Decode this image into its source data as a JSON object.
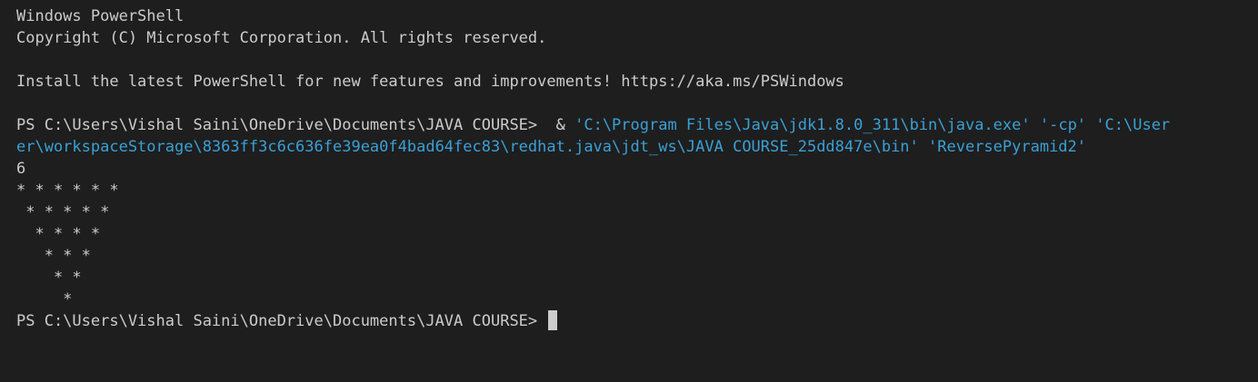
{
  "terminal": {
    "banner": {
      "title": "Windows PowerShell",
      "copyright": "Copyright (C) Microsoft Corporation. All rights reserved.",
      "install_message": "Install the latest PowerShell for new features and improvements! https://aka.ms/PSWindows"
    },
    "command": {
      "prompt": "PS C:\\Users\\Vishal Saini\\OneDrive\\Documents\\JAVA COURSE> ",
      "operator": " & ",
      "java_path": "'C:\\Program Files\\Java\\jdk1.8.0_311\\bin\\java.exe'",
      "cp_flag": " '-cp' ",
      "classpath_start": "'C:\\User",
      "continuation": "er\\workspaceStorage\\8363ff3c6c636fe39ea0f4bad64fec83\\redhat.java\\jdt_ws\\JAVA COURSE_25dd847e\\bin' 'ReversePyramid2'"
    },
    "output": {
      "input_value": "6",
      "pyramid": [
        "* * * * * * ",
        " * * * * * ",
        "  * * * * ",
        "   * * * ",
        "    * * ",
        "     * "
      ]
    },
    "final_prompt": "PS C:\\Users\\Vishal Saini\\OneDrive\\Documents\\JAVA COURSE> ",
    "colors": {
      "background": "#1e1e1e",
      "text": "#cccccc",
      "string": "#3aa0d6",
      "cursor": "#cccccc"
    }
  }
}
